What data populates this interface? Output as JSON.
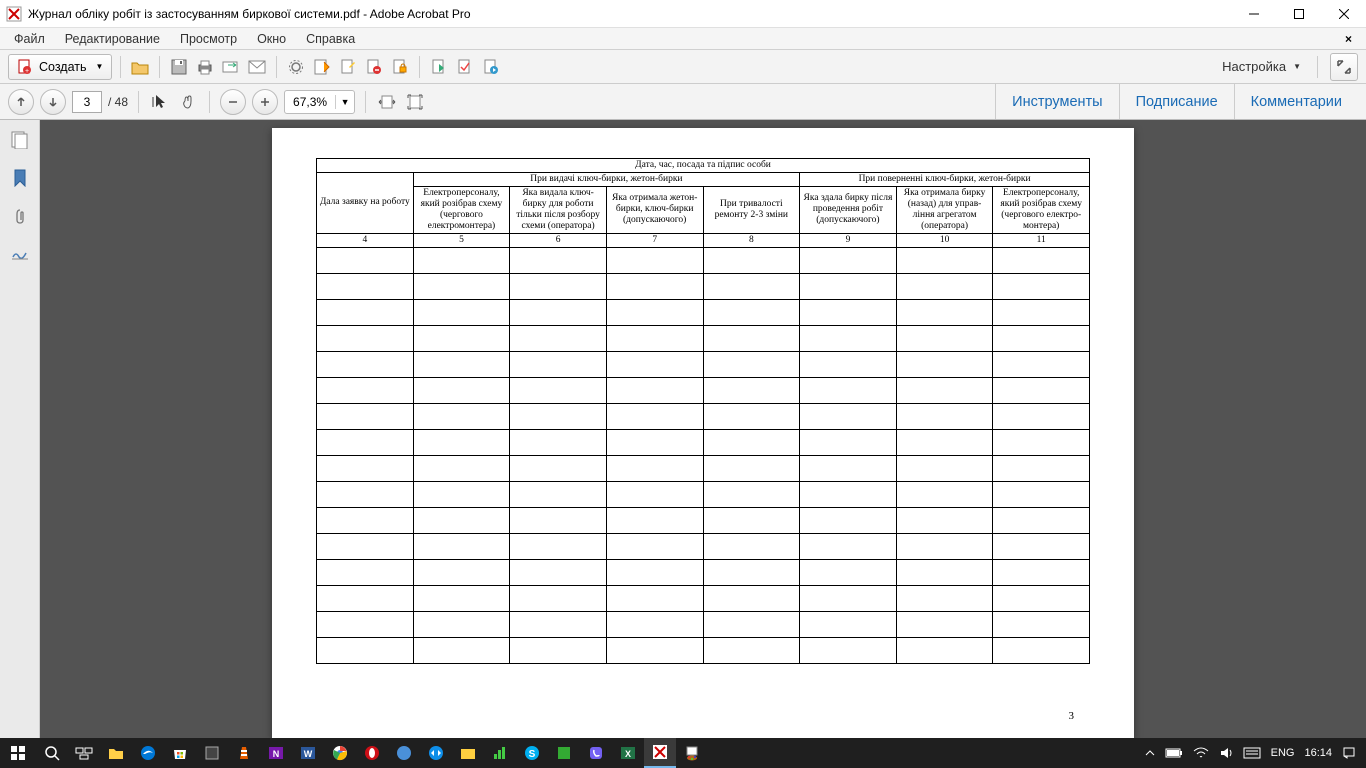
{
  "window": {
    "title": "Журнал обліку робіт із застосуванням биркової системи.pdf - Adobe Acrobat Pro"
  },
  "menu": {
    "file": "Файл",
    "edit": "Редактирование",
    "view": "Просмотр",
    "window": "Окно",
    "help": "Справка"
  },
  "toolbar": {
    "create": "Создать",
    "settings": "Настройка"
  },
  "nav": {
    "page_current": "3",
    "page_total": "/ 48",
    "zoom": "67,3%"
  },
  "tabs": {
    "tools": "Инструменты",
    "sign": "Подписание",
    "comments": "Комментарии"
  },
  "doc": {
    "header_main": "Дата, час, посада та підпис особи",
    "group1": "При видачі ключ-бирки, жетон-бирки",
    "group2": "При поверненні ключ-бирки, жетон-бирки",
    "col4": "Дала заявку на роботу",
    "col5": "Електроперсоналу, який розібрав схему (чергового електромонтера)",
    "col6": "Яка видала ключ-бирку для роботи тільки після розбору схеми (оператора)",
    "col7": "Яка отримала жетон-бирки, ключ-бирки (допускаючого)",
    "col8": "При тривалості ремонту 2-3 зміни",
    "col9": "Яка здала бирку після проведення робіт (допускаючого)",
    "col10": "Яка отримала бирку (назад) для управ-ління агрегатом (оператора)",
    "col11": "Електроперсоналу, який розібрав схему (чергового електро-монтера)",
    "n4": "4",
    "n5": "5",
    "n6": "6",
    "n7": "7",
    "n8": "8",
    "n9": "9",
    "n10": "10",
    "n11": "11",
    "page_num": "3"
  },
  "tray": {
    "lang": "ENG",
    "time": "16:14"
  }
}
